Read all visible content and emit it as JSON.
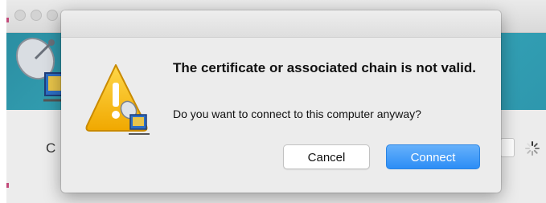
{
  "background_window": {
    "partial_label": "C"
  },
  "dialog": {
    "title": "The certificate or associated chain is not valid.",
    "message": "Do you want to connect to this computer anyway?",
    "icon": "warning-triangle-remote-desktop-icon",
    "buttons": {
      "cancel": "Cancel",
      "connect": "Connect"
    }
  },
  "colors": {
    "primary_button": "#2c8df6",
    "banner": "#3aaec0",
    "warning": "#f5b800"
  }
}
